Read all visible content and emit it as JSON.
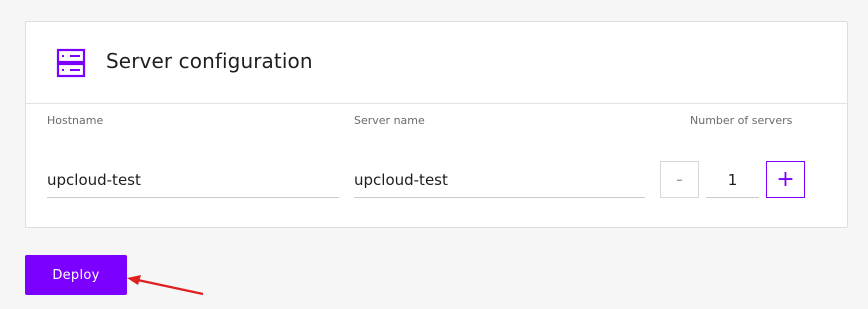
{
  "card": {
    "title": "Server configuration",
    "icon": "server-icon",
    "accent": "#7b00ff"
  },
  "fields": {
    "hostname": {
      "label": "Hostname",
      "value": "upcloud-test"
    },
    "server_name": {
      "label": "Server name",
      "value": "upcloud-test"
    },
    "server_count": {
      "label": "Number of servers",
      "value": "1",
      "decrement": "-",
      "increment": "+"
    }
  },
  "actions": {
    "deploy_label": "Deploy"
  },
  "annotation": {
    "color": "#e02020"
  }
}
